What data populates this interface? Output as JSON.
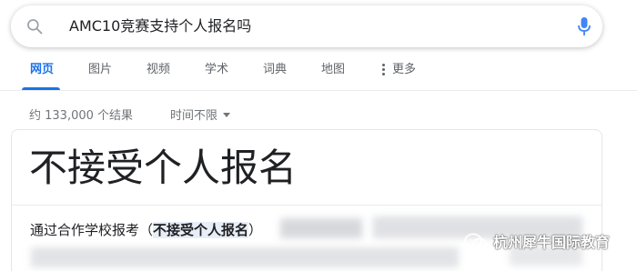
{
  "search": {
    "query": "AMC10竞赛支持个人报名吗"
  },
  "tabs": [
    {
      "label": "网页",
      "active": true
    },
    {
      "label": "图片",
      "active": false
    },
    {
      "label": "视频",
      "active": false
    },
    {
      "label": "学术",
      "active": false
    },
    {
      "label": "词典",
      "active": false
    },
    {
      "label": "地图",
      "active": false
    },
    {
      "label": "更多",
      "active": false
    }
  ],
  "stats": {
    "result_count": "约 133,000 个结果",
    "time_filter": "时间不限"
  },
  "answer_card": {
    "title": "不接受个人报名",
    "snippet_prefix": "通过合作学校报考（",
    "snippet_highlight": "不接受个人报名",
    "snippet_suffix": "）"
  },
  "watermark": {
    "text": "杭州犀牛国际教育"
  },
  "colors": {
    "accent": "#1a73e8",
    "muted": "#70757a",
    "text": "#202124",
    "highlight": "#e8eef7"
  }
}
